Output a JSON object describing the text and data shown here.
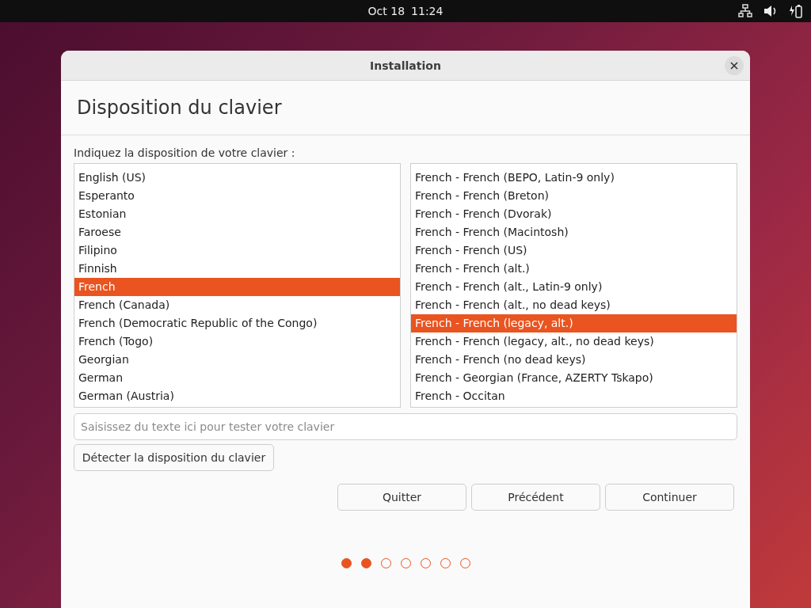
{
  "top_bar": {
    "date": "Oct 18",
    "time": "11:24"
  },
  "window": {
    "title": "Installation",
    "heading": "Disposition du clavier",
    "prompt": "Indiquez la disposition de votre clavier :",
    "layouts": [
      {
        "label": "English (US)",
        "selected": false
      },
      {
        "label": "Esperanto",
        "selected": false
      },
      {
        "label": "Estonian",
        "selected": false
      },
      {
        "label": "Faroese",
        "selected": false
      },
      {
        "label": "Filipino",
        "selected": false
      },
      {
        "label": "Finnish",
        "selected": false
      },
      {
        "label": "French",
        "selected": true
      },
      {
        "label": "French (Canada)",
        "selected": false
      },
      {
        "label": "French (Democratic Republic of the Congo)",
        "selected": false
      },
      {
        "label": "French (Togo)",
        "selected": false
      },
      {
        "label": "Georgian",
        "selected": false
      },
      {
        "label": "German",
        "selected": false
      },
      {
        "label": "German (Austria)",
        "selected": false
      }
    ],
    "variants": [
      {
        "label": "French - French (BEPO, Latin-9 only)",
        "selected": false
      },
      {
        "label": "French - French (Breton)",
        "selected": false
      },
      {
        "label": "French - French (Dvorak)",
        "selected": false
      },
      {
        "label": "French - French (Macintosh)",
        "selected": false
      },
      {
        "label": "French - French (US)",
        "selected": false
      },
      {
        "label": "French - French (alt.)",
        "selected": false
      },
      {
        "label": "French - French (alt., Latin-9 only)",
        "selected": false
      },
      {
        "label": "French - French (alt., no dead keys)",
        "selected": false
      },
      {
        "label": "French - French (legacy, alt.)",
        "selected": true
      },
      {
        "label": "French - French (legacy, alt., no dead keys)",
        "selected": false
      },
      {
        "label": "French - French (no dead keys)",
        "selected": false
      },
      {
        "label": "French - Georgian (France, AZERTY Tskapo)",
        "selected": false
      },
      {
        "label": "French - Occitan",
        "selected": false
      }
    ],
    "test_field": {
      "placeholder": "Saisissez du texte ici pour tester votre clavier"
    },
    "detect_button": "Détecter la disposition du clavier",
    "buttons": [
      "Quitter",
      "Précédent",
      "Continuer"
    ],
    "steps": [
      {
        "done": true
      },
      {
        "done": true
      },
      {
        "done": false
      },
      {
        "done": false
      },
      {
        "done": false
      },
      {
        "done": false
      },
      {
        "done": false
      }
    ]
  }
}
